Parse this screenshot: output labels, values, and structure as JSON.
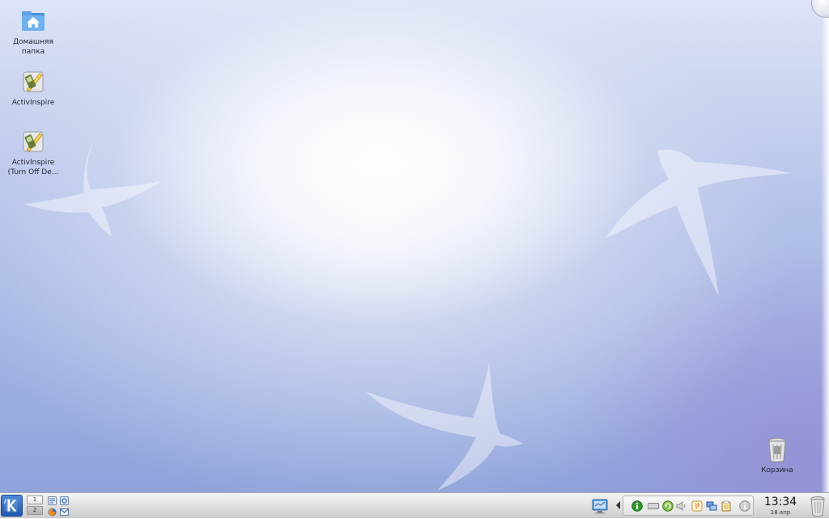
{
  "desktop": {
    "icons": [
      {
        "id": "home",
        "icon": "home-folder-icon",
        "label": "Домашняя\nпапка"
      },
      {
        "id": "activ1",
        "icon": "activinspire-icon",
        "label": "ActivInspire"
      },
      {
        "id": "activ2",
        "icon": "activinspire-icon",
        "label": "ActivInspire\n(Turn Off De..."
      }
    ],
    "trash": {
      "icon": "trash-icon",
      "label": "Корзина"
    }
  },
  "taskbar": {
    "kmenu_icon": "kde-k-menu-icon",
    "pager": {
      "desktops": [
        "1",
        "2"
      ],
      "active": "2"
    },
    "quick_launch": [
      "file-manager-icon",
      "system-settings-icon",
      "firefox-icon",
      "mail-icon"
    ],
    "show_desktop_icon": "show-desktop-icon",
    "tray_icons": [
      "tray-expand-arrow-icon",
      "info-green-icon",
      "keyboard-icon",
      "update-icon",
      "volume-icon",
      "java-icon",
      "network-icon",
      "clipboard-icon",
      "notifications-icon"
    ],
    "clock": {
      "time": "13:34",
      "date": "18 апр"
    },
    "trash_icon": "trash-icon"
  },
  "colors": {
    "desktop_top": "#dde4f6",
    "desktop_bottom": "#8fa3db",
    "taskbar": "#dedede",
    "kde_blue": "#1e58b0"
  }
}
